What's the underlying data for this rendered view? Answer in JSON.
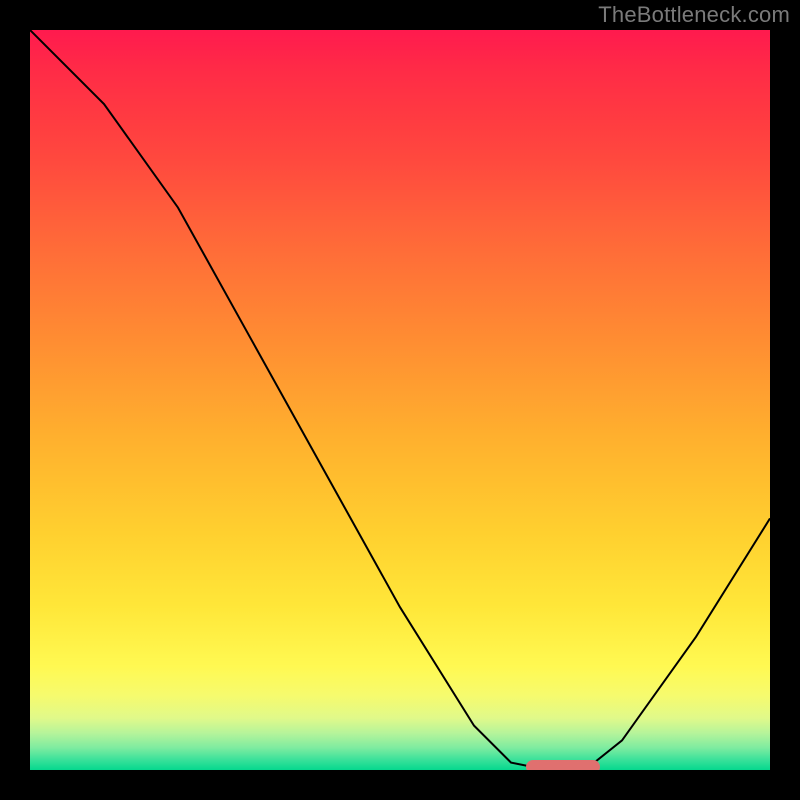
{
  "attribution": "TheBottleneck.com",
  "chart_data": {
    "type": "line",
    "title": "",
    "xlabel": "",
    "ylabel": "",
    "ylim": [
      0,
      100
    ],
    "x": [
      0,
      10,
      20,
      30,
      40,
      50,
      60,
      65,
      70,
      75,
      80,
      90,
      100
    ],
    "values": [
      100,
      90,
      76,
      58,
      40,
      22,
      6,
      1,
      0,
      0,
      4,
      18,
      34
    ],
    "gradient_stops": [
      {
        "pos": 0.0,
        "color": "#ff1a4e"
      },
      {
        "pos": 0.05,
        "color": "#ff2a47"
      },
      {
        "pos": 0.12,
        "color": "#ff3b41"
      },
      {
        "pos": 0.18,
        "color": "#ff4a3e"
      },
      {
        "pos": 0.3,
        "color": "#ff6d38"
      },
      {
        "pos": 0.42,
        "color": "#ff8d32"
      },
      {
        "pos": 0.55,
        "color": "#ffb02e"
      },
      {
        "pos": 0.68,
        "color": "#ffd02f"
      },
      {
        "pos": 0.78,
        "color": "#ffe739"
      },
      {
        "pos": 0.86,
        "color": "#fff952"
      },
      {
        "pos": 0.9,
        "color": "#f6fb6e"
      },
      {
        "pos": 0.93,
        "color": "#e0f98a"
      },
      {
        "pos": 0.95,
        "color": "#b6f49a"
      },
      {
        "pos": 0.97,
        "color": "#7eeca0"
      },
      {
        "pos": 0.985,
        "color": "#3fe29b"
      },
      {
        "pos": 1.0,
        "color": "#05d88e"
      }
    ],
    "marker": {
      "x_start": 67,
      "x_end": 77,
      "y": 0,
      "color": "#e0706f"
    }
  }
}
